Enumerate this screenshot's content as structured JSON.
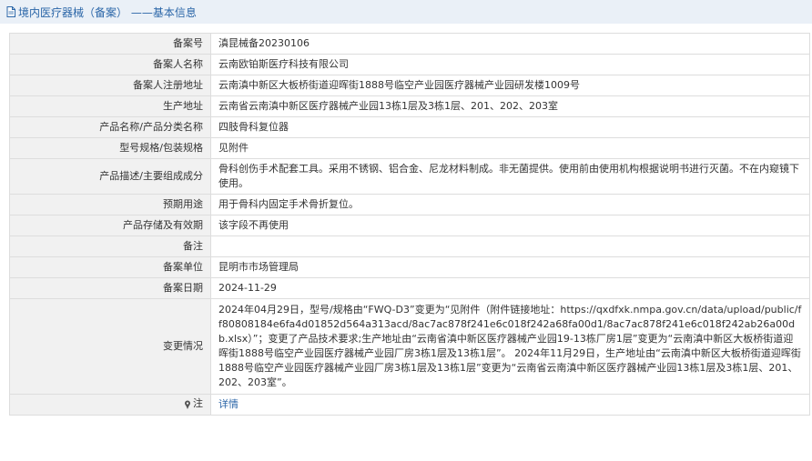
{
  "header": {
    "title": "境内医疗器械（备案） ——基本信息"
  },
  "rows": [
    {
      "label": "备案号",
      "value": "滇昆械备20230106"
    },
    {
      "label": "备案人名称",
      "value": "云南欧铂斯医疗科技有限公司"
    },
    {
      "label": "备案人注册地址",
      "value": "云南滇中新区大板桥街道迎晖街1888号临空产业园医疗器械产业园研发楼1009号"
    },
    {
      "label": "生产地址",
      "value": "云南省云南滇中新区医疗器械产业园13栋1层及3栋1层、201、202、203室"
    },
    {
      "label": "产品名称/产品分类名称",
      "value": "四肢骨科复位器"
    },
    {
      "label": "型号规格/包装规格",
      "value": "见附件"
    },
    {
      "label": "产品描述/主要组成成分",
      "value": "骨科创伤手术配套工具。采用不锈钢、铝合金、尼龙材料制成。非无菌提供。使用前由使用机构根据说明书进行灭菌。不在内窥镜下使用。"
    },
    {
      "label": "预期用途",
      "value": "用于骨科内固定手术骨折复位。"
    },
    {
      "label": "产品存储及有效期",
      "value": "该字段不再使用"
    },
    {
      "label": "备注",
      "value": ""
    },
    {
      "label": "备案单位",
      "value": "昆明市市场管理局"
    },
    {
      "label": "备案日期",
      "value": "2024-11-29"
    },
    {
      "label": "变更情况",
      "value": "2024年04月29日，型号/规格由“FWQ-D3”变更为“见附件（附件链接地址：https://qxdfxk.nmpa.gov.cn/data/upload/public/ff80808184e6fa4d01852d564a313acd/8ac7ac878f241e6c018f242a68fa00d1/8ac7ac878f241e6c018f242ab26a00db.xlsx）”；变更了产品技术要求;生产地址由“云南省滇中新区医疗器械产业园19-13栋厂房1层”变更为“云南滇中新区大板桥街道迎晖街1888号临空产业园医疗器械产业园厂房3栋1层及13栋1层”。 2024年11月29日，生产地址由“云南滇中新区大板桥街道迎晖街1888号临空产业园医疗器械产业园厂房3栋1层及13栋1层”变更为“云南省云南滇中新区医疗器械产业园13栋1层及3栋1层、201、202、203室”。"
    }
  ],
  "note": {
    "label": "注",
    "link_text": "详情"
  },
  "colors": {
    "title_bg": "#eaf0f7",
    "link": "#2b66a8",
    "label_bg": "#f1f1f1",
    "border": "#dddddd"
  }
}
